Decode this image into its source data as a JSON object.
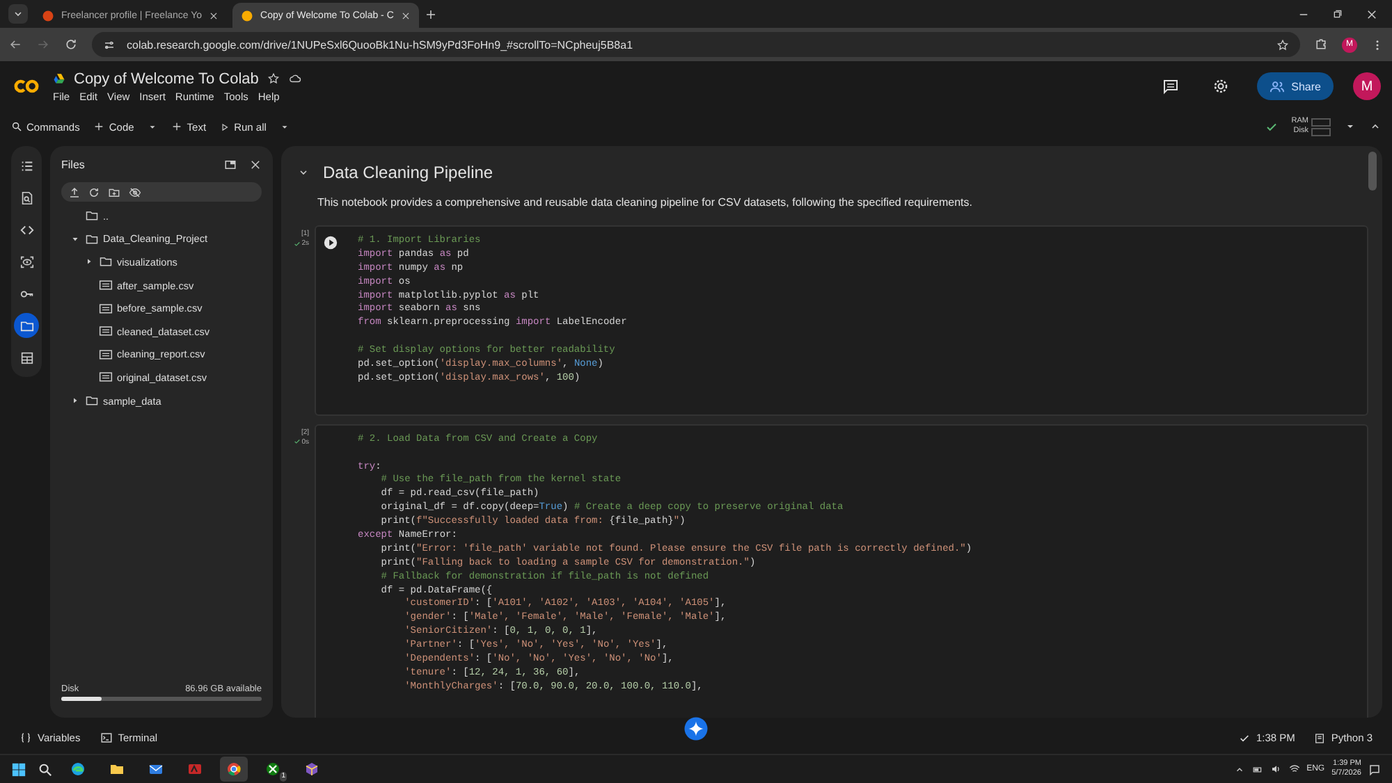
{
  "browser": {
    "tabs": [
      {
        "title": "Freelancer profile | Freelance Yo",
        "selected": false
      },
      {
        "title": "Copy of Welcome To Colab - C",
        "selected": true
      }
    ],
    "url": "colab.research.google.com/drive/1NUPeSxl6QuooBk1Nu-hSM9yPd3FoHn9_#scrollTo=NCpheuj5B8a1",
    "profile": "M"
  },
  "header": {
    "title": "Copy of Welcome To Colab",
    "menu": [
      "File",
      "Edit",
      "View",
      "Insert",
      "Runtime",
      "Tools",
      "Help"
    ],
    "share": "Share",
    "avatar": "M"
  },
  "toolbar": {
    "commands": "Commands",
    "code": "Code",
    "text": "Text",
    "run_all": "Run all",
    "ram": "RAM",
    "disk": "Disk"
  },
  "side_rail": [
    {
      "kind": "toc",
      "selected": false
    },
    {
      "kind": "find",
      "selected": false
    },
    {
      "kind": "code",
      "selected": false
    },
    {
      "kind": "vars",
      "selected": false
    },
    {
      "kind": "key",
      "selected": false
    },
    {
      "kind": "files",
      "selected": true
    },
    {
      "kind": "table",
      "selected": false
    }
  ],
  "files": {
    "title": "Files",
    "tree": [
      {
        "name": "..",
        "kind": "folder"
      },
      {
        "name": "Data_Cleaning_Project",
        "kind": "folder",
        "expanded": true,
        "children": [
          {
            "name": "visualizations",
            "kind": "folder",
            "expanded": false
          },
          {
            "name": "after_sample.csv",
            "kind": "csv"
          },
          {
            "name": "before_sample.csv",
            "kind": "csv"
          },
          {
            "name": "cleaned_dataset.csv",
            "kind": "csv"
          },
          {
            "name": "cleaning_report.csv",
            "kind": "csv"
          },
          {
            "name": "original_dataset.csv",
            "kind": "csv"
          }
        ]
      },
      {
        "name": "sample_data",
        "kind": "folder",
        "expanded": false
      }
    ],
    "disk_label": "Disk",
    "disk_available": "86.96 GB available",
    "level": 0.2
  },
  "notebook": {
    "section": {
      "title": "Data Cleaning Pipeline",
      "expanded": true
    },
    "paragraph": "This notebook provides a comprehensive and reusable data cleaning pipeline for CSV datasets, following the specified requirements.",
    "cells": [
      {
        "count": "[1]",
        "time": "2s",
        "run_button": true,
        "lines": [
          {
            "kind": "code",
            "tokens": [
              {
                "kind": "comment",
                "text": "# 1. Import Libraries"
              }
            ]
          },
          {
            "kind": "code",
            "tokens": [
              {
                "kind": "keyword",
                "text": "import"
              },
              {
                "kind": "plain",
                "text": " pandas "
              },
              {
                "kind": "keyword",
                "text": "as"
              },
              {
                "kind": "plain",
                "text": " pd"
              }
            ]
          },
          {
            "kind": "code",
            "tokens": [
              {
                "kind": "keyword",
                "text": "import"
              },
              {
                "kind": "plain",
                "text": " numpy "
              },
              {
                "kind": "keyword",
                "text": "as"
              },
              {
                "kind": "plain",
                "text": " np"
              }
            ]
          },
          {
            "kind": "code",
            "tokens": [
              {
                "kind": "keyword",
                "text": "import"
              },
              {
                "kind": "plain",
                "text": " os"
              }
            ]
          },
          {
            "kind": "code",
            "tokens": [
              {
                "kind": "keyword",
                "text": "import"
              },
              {
                "kind": "plain",
                "text": " matplotlib.pyplot "
              },
              {
                "kind": "keyword",
                "text": "as"
              },
              {
                "kind": "plain",
                "text": " plt"
              }
            ]
          },
          {
            "kind": "code",
            "tokens": [
              {
                "kind": "keyword",
                "text": "import"
              },
              {
                "kind": "plain",
                "text": " seaborn "
              },
              {
                "kind": "keyword",
                "text": "as"
              },
              {
                "kind": "plain",
                "text": " sns"
              }
            ]
          },
          {
            "kind": "code",
            "tokens": [
              {
                "kind": "keyword",
                "text": "from"
              },
              {
                "kind": "plain",
                "text": " sklearn.preprocessing "
              },
              {
                "kind": "keyword",
                "text": "import"
              },
              {
                "kind": "plain",
                "text": " LabelEncoder"
              }
            ]
          },
          {
            "kind": "blank"
          },
          {
            "kind": "code",
            "tokens": [
              {
                "kind": "comment",
                "text": "# Set display options for better readability"
              }
            ]
          },
          {
            "kind": "code",
            "tokens": [
              {
                "kind": "plain",
                "text": "pd.set_option("
              },
              {
                "kind": "string",
                "text": "'display.max_columns'"
              },
              {
                "kind": "plain",
                "text": ", "
              },
              {
                "kind": "constant",
                "text": "None"
              },
              {
                "kind": "plain",
                "text": ")"
              }
            ]
          },
          {
            "kind": "code",
            "tokens": [
              {
                "kind": "plain",
                "text": "pd.set_option("
              },
              {
                "kind": "string",
                "text": "'display.max_rows'"
              },
              {
                "kind": "plain",
                "text": ", "
              },
              {
                "kind": "number",
                "text": "100"
              },
              {
                "kind": "plain",
                "text": ")"
              }
            ]
          }
        ]
      },
      {
        "count": "[2]",
        "time": "0s",
        "run_button": false,
        "lines": [
          {
            "kind": "code",
            "tokens": [
              {
                "kind": "comment",
                "text": "# 2. Load Data from CSV and Create a Copy"
              }
            ]
          },
          {
            "kind": "blank"
          },
          {
            "kind": "code",
            "tokens": [
              {
                "kind": "keyword",
                "text": "try"
              },
              {
                "kind": "plain",
                "text": ":"
              }
            ]
          },
          {
            "kind": "code",
            "tokens": [
              {
                "kind": "comment",
                "text": "    # Use the file_path from the kernel state"
              }
            ]
          },
          {
            "kind": "code",
            "tokens": [
              {
                "kind": "plain",
                "text": "    df = pd.read_csv(file_path)"
              }
            ]
          },
          {
            "kind": "code",
            "tokens": [
              {
                "kind": "plain",
                "text": "    original_df = df.copy(deep="
              },
              {
                "kind": "constant",
                "text": "True"
              },
              {
                "kind": "plain",
                "text": ") "
              },
              {
                "kind": "comment",
                "text": "# Create a deep copy to preserve original data"
              }
            ]
          },
          {
            "kind": "code",
            "tokens": [
              {
                "kind": "plain",
                "text": "    print("
              },
              {
                "kind": "string",
                "text": "f\"Successfully loaded data from: "
              },
              {
                "kind": "plain",
                "text": "{file_path}"
              },
              {
                "kind": "string",
                "text": "\""
              },
              {
                "kind": "plain",
                "text": ")"
              }
            ]
          },
          {
            "kind": "code",
            "tokens": [
              {
                "kind": "keyword",
                "text": "except"
              },
              {
                "kind": "plain",
                "text": " NameError:"
              }
            ]
          },
          {
            "kind": "code",
            "tokens": [
              {
                "kind": "plain",
                "text": "    print("
              },
              {
                "kind": "string",
                "text": "\"Error: 'file_path' variable not found. Please ensure the CSV file path is correctly defined.\""
              },
              {
                "kind": "plain",
                "text": ")"
              }
            ]
          },
          {
            "kind": "code",
            "tokens": [
              {
                "kind": "plain",
                "text": "    print("
              },
              {
                "kind": "string",
                "text": "\"Falling back to loading a sample CSV for demonstration.\""
              },
              {
                "kind": "plain",
                "text": ")"
              }
            ]
          },
          {
            "kind": "code",
            "tokens": [
              {
                "kind": "comment",
                "text": "    # Fallback for demonstration if file_path is not defined"
              }
            ]
          },
          {
            "kind": "code",
            "tokens": [
              {
                "kind": "plain",
                "text": "    df = pd.DataFrame({"
              }
            ]
          },
          {
            "kind": "code",
            "tokens": [
              {
                "kind": "string",
                "text": "        'customerID'"
              },
              {
                "kind": "plain",
                "text": ": ["
              },
              {
                "kind": "string",
                "text": "'A101', 'A102', 'A103', 'A104', 'A105'"
              },
              {
                "kind": "plain",
                "text": "],"
              }
            ]
          },
          {
            "kind": "code",
            "tokens": [
              {
                "kind": "string",
                "text": "        'gender'"
              },
              {
                "kind": "plain",
                "text": ": ["
              },
              {
                "kind": "string",
                "text": "'Male', 'Female', 'Male', 'Female', 'Male'"
              },
              {
                "kind": "plain",
                "text": "],"
              }
            ]
          },
          {
            "kind": "code",
            "tokens": [
              {
                "kind": "string",
                "text": "        'SeniorCitizen'"
              },
              {
                "kind": "plain",
                "text": ": ["
              },
              {
                "kind": "number",
                "text": "0, 1, 0, 0, 1"
              },
              {
                "kind": "plain",
                "text": "],"
              }
            ]
          },
          {
            "kind": "code",
            "tokens": [
              {
                "kind": "string",
                "text": "        'Partner'"
              },
              {
                "kind": "plain",
                "text": ": ["
              },
              {
                "kind": "string",
                "text": "'Yes', 'No', 'Yes', 'No', 'Yes'"
              },
              {
                "kind": "plain",
                "text": "],"
              }
            ]
          },
          {
            "kind": "code",
            "tokens": [
              {
                "kind": "string",
                "text": "        'Dependents'"
              },
              {
                "kind": "plain",
                "text": ": ["
              },
              {
                "kind": "string",
                "text": "'No', 'No', 'Yes', 'No', 'No'"
              },
              {
                "kind": "plain",
                "text": "],"
              }
            ]
          },
          {
            "kind": "code",
            "tokens": [
              {
                "kind": "string",
                "text": "        'tenure'"
              },
              {
                "kind": "plain",
                "text": ": ["
              },
              {
                "kind": "number",
                "text": "12, 24, 1, 36, 60"
              },
              {
                "kind": "plain",
                "text": "],"
              }
            ]
          },
          {
            "kind": "code",
            "tokens": [
              {
                "kind": "string",
                "text": "        'MonthlyCharges'"
              },
              {
                "kind": "plain",
                "text": ": ["
              },
              {
                "kind": "number",
                "text": "70.0, 90.0, 20.0, 100.0, 110.0"
              },
              {
                "kind": "plain",
                "text": "],"
              }
            ]
          }
        ]
      }
    ]
  },
  "status_bar": {
    "variables": "Variables",
    "terminal": "Terminal",
    "time": "1:38 PM",
    "runtime": "Python 3"
  },
  "taskbar": {
    "apps": [
      {
        "kind": "edge",
        "selected": false
      },
      {
        "kind": "folder",
        "selected": false
      },
      {
        "kind": "mail",
        "selected": false
      },
      {
        "kind": "red",
        "selected": false
      },
      {
        "kind": "chrome",
        "selected": true
      },
      {
        "kind": "xbox",
        "selected": false,
        "badge": "1"
      },
      {
        "kind": "cube",
        "selected": false
      }
    ],
    "language": "ENG",
    "time": "1:39 PM",
    "date": "5/7/2026"
  }
}
